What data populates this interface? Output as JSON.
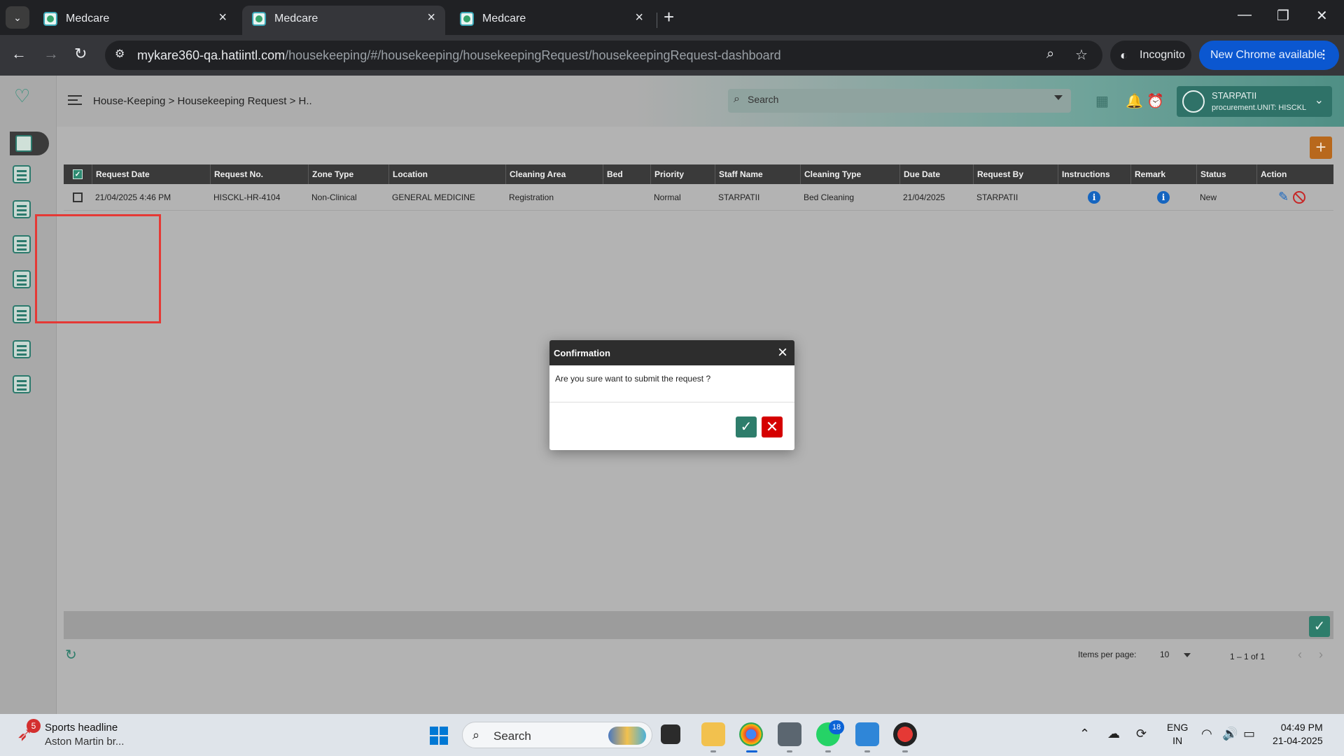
{
  "browser": {
    "tabs": [
      {
        "title": "Medcare",
        "active": false
      },
      {
        "title": "Medcare",
        "active": true
      },
      {
        "title": "Medcare",
        "active": false
      }
    ],
    "url_host": "mykare360-qa.hatiintl.com",
    "url_path": "/housekeeping/#/housekeeping/housekeepingRequest/housekeepingRequest-dashboard",
    "incognito_label": "Incognito",
    "update_label": "New Chrome available"
  },
  "header": {
    "breadcrumb": "House-Keeping > Housekeeping Request > H..",
    "search_placeholder": "Search",
    "user_name": "STARPATII",
    "user_role": "procurement.UNIT: HISCKL"
  },
  "grid": {
    "columns": [
      "Request Date",
      "Request No.",
      "Zone Type",
      "Location",
      "Cleaning Area",
      "Bed",
      "Priority",
      "Staff Name",
      "Cleaning Type",
      "Due Date",
      "Request By",
      "Instructions",
      "Remark",
      "Status",
      "Action"
    ],
    "rows": [
      {
        "request_date": "21/04/2025 4:46 PM",
        "request_no": "HISCKL-HR-4104",
        "zone_type": "Non-Clinical",
        "location": "GENERAL MEDICINE",
        "cleaning_area": "Registration",
        "bed": "",
        "priority": "Normal",
        "staff_name": "STARPATII",
        "cleaning_type": "Bed Cleaning",
        "due_date": "21/04/2025",
        "request_by": "STARPATII",
        "status": "New"
      }
    ]
  },
  "pagination": {
    "items_per_page_label": "Items per page:",
    "items_per_page": "10",
    "range": "1 – 1 of 1"
  },
  "dialog": {
    "title": "Confirmation",
    "message": "Are you sure want to submit the request ?"
  },
  "taskbar": {
    "news_count": "5",
    "news_title": "Sports headline",
    "news_sub": "Aston Martin br...",
    "search_label": "Search",
    "whatsapp_badge": "18",
    "lang_1": "ENG",
    "lang_2": "IN",
    "time": "04:49 PM",
    "date": "21-04-2025"
  },
  "colors": {
    "accent": "#2e7d6b",
    "add_button": "#b8681c",
    "cancel": "#d50000",
    "info": "#1565c0",
    "highlight": "#e53935"
  }
}
